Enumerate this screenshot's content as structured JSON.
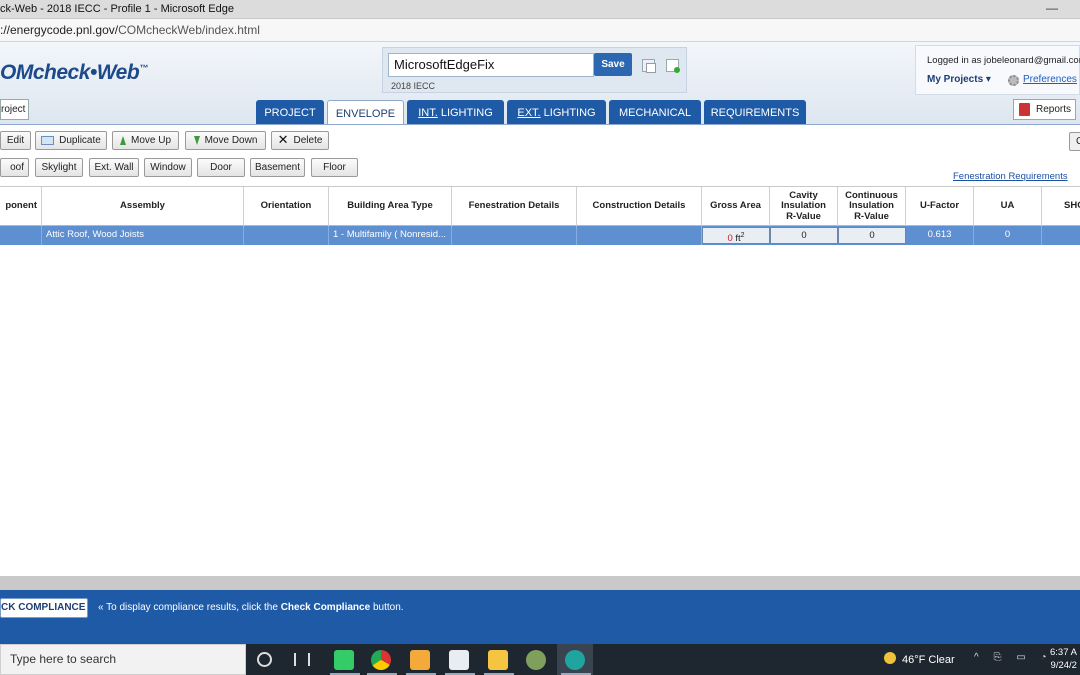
{
  "window": {
    "title": "ck-Web - 2018 IECC - Profile 1 - Microsoft Edge",
    "minimize_glyph": "—"
  },
  "address": {
    "url_prefix": "://energycode.pnl.gov/",
    "url_path": "COMcheckWeb/index.html"
  },
  "app": {
    "logo_text": "OMcheck•Web",
    "logo_tm": "™",
    "project_name": "MicrosoftEdgeFix",
    "save_label": "Save",
    "code_version": "2018 IECC",
    "logged_in": "Logged in as jobeleonard@gmail.com",
    "my_projects": "My Projects ▾",
    "preferences": "Preferences",
    "project_button": "roject",
    "reports_button": "Reports"
  },
  "tabs": [
    {
      "label": "PROJECT",
      "active": false
    },
    {
      "label": "ENVELOPE",
      "active": true
    },
    {
      "label_u": "INT.",
      "label_rest": " LIGHTING",
      "active": false
    },
    {
      "label_u": "EXT.",
      "label_rest": " LIGHTING",
      "active": false
    },
    {
      "label": "MECHANICAL",
      "active": false
    },
    {
      "label": "REQUIREMENTS",
      "active": false
    }
  ],
  "toolbar": {
    "edit": "Edit",
    "duplicate": "Duplicate",
    "move_up": "Move Up",
    "move_down": "Move Down",
    "delete": "Delete",
    "right_stub": "C",
    "add_buttons": [
      "oof",
      "Skylight",
      "Ext. Wall",
      "Window",
      "Door",
      "Basement",
      "Floor"
    ],
    "fenestration_link": "Fenestration Requirements"
  },
  "grid": {
    "headers": [
      {
        "key": "component",
        "lines": [
          "ponent"
        ]
      },
      {
        "key": "assembly",
        "lines": [
          "Assembly"
        ]
      },
      {
        "key": "orientation",
        "lines": [
          "Orientation"
        ]
      },
      {
        "key": "building_area_type",
        "lines": [
          "Building Area Type"
        ]
      },
      {
        "key": "fenestration",
        "lines": [
          "Fenestration Details"
        ]
      },
      {
        "key": "construction",
        "lines": [
          "Construction Details"
        ]
      },
      {
        "key": "gross_area",
        "lines": [
          "Gross Area"
        ]
      },
      {
        "key": "cavity",
        "lines": [
          "Cavity",
          "Insulation",
          "R-Value"
        ]
      },
      {
        "key": "continuous",
        "lines": [
          "Continuous",
          "Insulation",
          "R-Value"
        ]
      },
      {
        "key": "u_factor",
        "lines": [
          "U-Factor"
        ]
      },
      {
        "key": "ua",
        "lines": [
          "UA"
        ]
      },
      {
        "key": "shgc",
        "lines": [
          "SHG"
        ]
      }
    ],
    "row": {
      "component": "",
      "assembly": "Attic Roof, Wood Joists",
      "orientation": "",
      "building_area_type": "1 - Multifamily ( Nonresid...",
      "fenestration": "",
      "construction": "",
      "gross_area_value": "0",
      "gross_area_unit": "ft",
      "gross_area_exp": "2",
      "cavity": "0",
      "continuous": "0",
      "u_factor": "0.613",
      "ua": "0",
      "shgc": ""
    }
  },
  "compliance": {
    "button": "CK COMPLIANCE",
    "message_prefix": "« To display compliance results, click the ",
    "message_bold": "Check Compliance",
    "message_suffix": " button."
  },
  "taskbar": {
    "search_placeholder": "Type here to search",
    "weather": "46°F  Clear",
    "tray_glyphs": "^ ⎘ ▭ ◔",
    "time": "6:37 A",
    "date": "9/24/2"
  }
}
